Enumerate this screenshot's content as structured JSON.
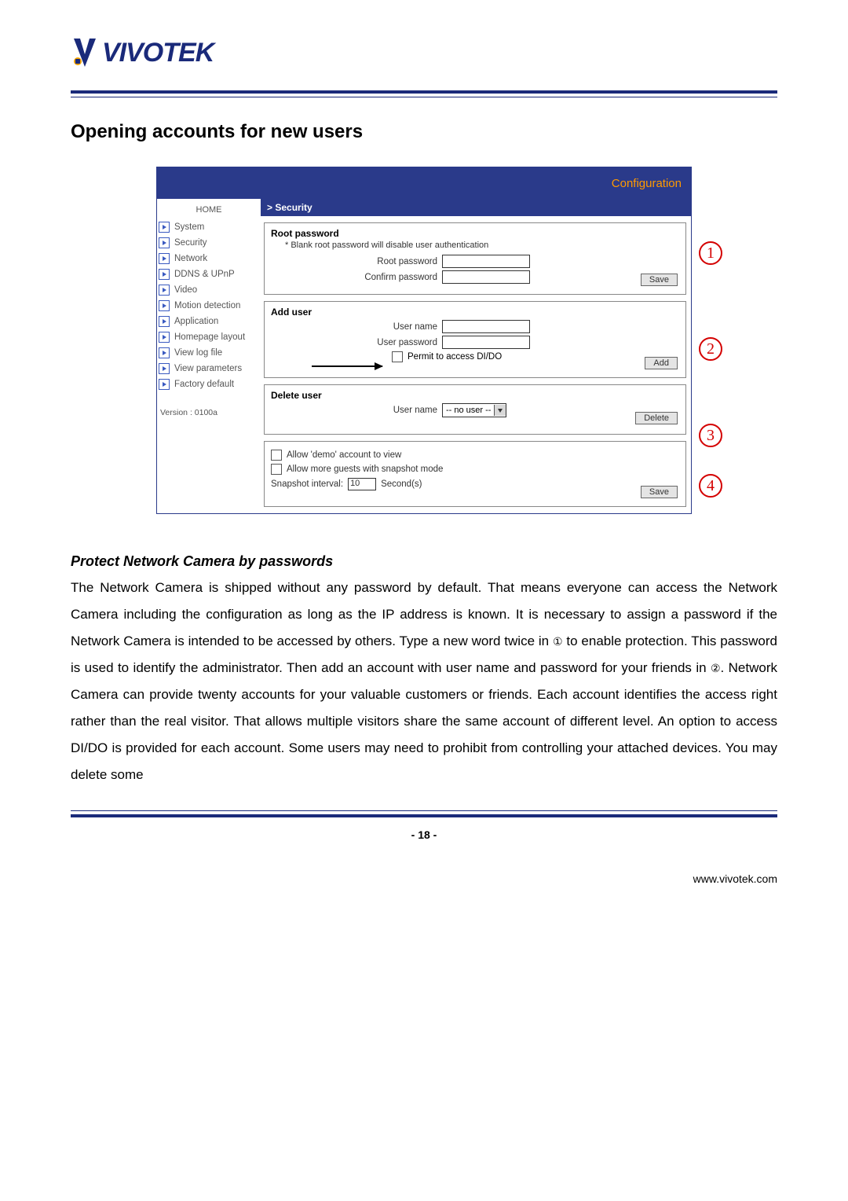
{
  "logo": {
    "text": "VIVOTEK"
  },
  "title": "Opening accounts for new users",
  "config_header": "Configuration",
  "sidebar": {
    "home": "HOME",
    "items": [
      "System",
      "Security",
      "Network",
      "DDNS & UPnP",
      "Video",
      "Motion detection",
      "Application",
      "Homepage layout",
      "View log file",
      "View parameters",
      "Factory default"
    ],
    "version": "Version : 0100a"
  },
  "crumb": "> Security",
  "sections": {
    "root": {
      "legend": "Root password",
      "note": "* Blank root password will disable user authentication",
      "labels": {
        "pwd": "Root password",
        "confirm": "Confirm password"
      },
      "button": "Save"
    },
    "add": {
      "legend": "Add user",
      "labels": {
        "name": "User name",
        "pwd": "User password"
      },
      "permit": "Permit to access DI/DO",
      "button": "Add"
    },
    "del": {
      "legend": "Delete user",
      "label": "User name",
      "select_value": "-- no user --",
      "button": "Delete"
    },
    "guest": {
      "allow_demo": "Allow 'demo' account to view",
      "allow_snap": "Allow more guests with snapshot mode",
      "snap_label_a": "Snapshot interval:",
      "snap_value": "10",
      "snap_label_b": "Second(s)",
      "button": "Save"
    },
    "annotations": {
      "a1": "1",
      "a2": "2",
      "a3": "3",
      "a4": "4"
    }
  },
  "subhead": "Protect Network Camera by passwords",
  "body_a": "The Network Camera is shipped without any password by default. That means everyone can access the Network Camera including the configuration as long as the IP address is known. It is necessary to assign a password if the Network Camera is intended to be accessed by others. Type a new word twice in ",
  "ref1": "①",
  "body_b": " to enable protection. This password is used to identify the administrator. Then add an account with user name and password for your friends in ",
  "ref2": "②",
  "body_c": ". Network Camera can provide twenty accounts for your valuable customers or friends. Each account identifies the access right rather than the real visitor. That allows multiple visitors share the same account of different level.  An option to access DI/DO is provided for each account. Some users may need to prohibit from controlling your attached devices. You may delete some",
  "page_number": "- 18 -",
  "url": "www.vivotek.com"
}
